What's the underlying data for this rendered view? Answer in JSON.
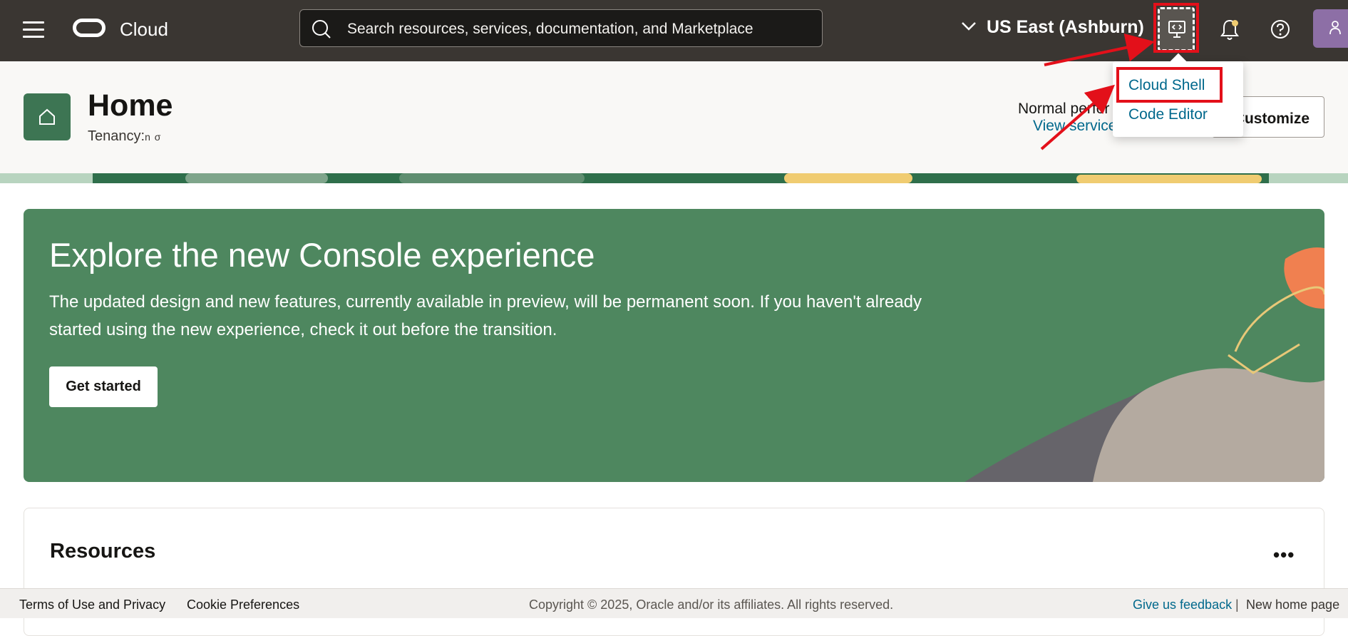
{
  "topbar": {
    "brand": "Cloud",
    "search_placeholder": "Search resources, services, documentation, and Marketplace",
    "region": "US East (Ashburn)",
    "icons": [
      "menu-icon",
      "oracle-logo",
      "search-icon",
      "chevron-down-icon",
      "cloud-shell-icon",
      "bell-icon",
      "help-icon",
      "user-icon"
    ]
  },
  "header": {
    "title": "Home",
    "tenancy_label": "Tenancy:",
    "tenancy_value": "n σ",
    "status_text": "Normal perfor",
    "status_link": "View service",
    "customize_label": "Customize"
  },
  "dropdown": {
    "items": [
      "Cloud Shell",
      "Code Editor"
    ]
  },
  "banner": {
    "title": "Explore the new Console experience",
    "description": "The updated design and new features, currently available in preview, will be permanent soon. If you haven't already started using the new experience, check it out before the transition.",
    "button": "Get started"
  },
  "resources": {
    "title": "Resources",
    "menu": "•••"
  },
  "footer": {
    "terms": "Terms of Use and Privacy",
    "cookies": "Cookie Preferences",
    "copyright": "Copyright © 2025, Oracle and/or its affiliates. All rights reserved.",
    "feedback": "Give us feedback",
    "separator": "|",
    "new_home": "New home page"
  },
  "colors": {
    "topbar": "#3a3632",
    "banner": "#4e875f",
    "link": "#00688c",
    "highlight": "#e3101a"
  }
}
